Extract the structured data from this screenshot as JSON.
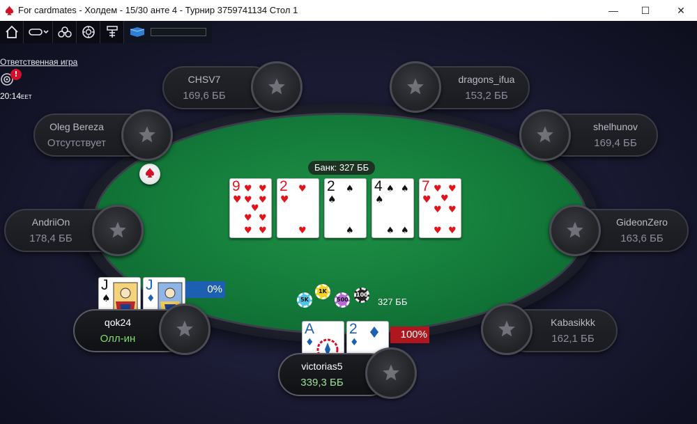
{
  "window": {
    "title": "For cardmates - Холдем - 15/30 анте 4 - Турнир 3759741134 Стол 1",
    "minimize": "—",
    "maximize": "☐",
    "close": "✕"
  },
  "toolbar": {
    "items": [
      "home-icon",
      "view-toggle-icon",
      "cards-icon",
      "poker-chip-icon",
      "lobby-icon",
      "battery-icon"
    ]
  },
  "responsible_gaming": "Ответственная игра",
  "clock": {
    "time": "20:14",
    "tz": "EET"
  },
  "alert": "!",
  "pot": "Банк: 327 ББ",
  "board": [
    {
      "rank": "9",
      "suit": "♥",
      "color": "red"
    },
    {
      "rank": "2",
      "suit": "♥",
      "color": "red"
    },
    {
      "rank": "2",
      "suit": "♠",
      "color": "black"
    },
    {
      "rank": "4",
      "suit": "♠",
      "color": "black"
    },
    {
      "rank": "7",
      "suit": "♥",
      "color": "red"
    }
  ],
  "chips": {
    "labels": [
      "5K",
      "1K",
      "500",
      "100"
    ],
    "amount": "327 ББ"
  },
  "seats": [
    {
      "name": "CHSV7",
      "stack": "169,6 ББ"
    },
    {
      "name": "dragons_ifua",
      "stack": "153,2 ББ"
    },
    {
      "name": "Oleg Bereza",
      "stack": "Отсутствует"
    },
    {
      "name": "shelhunov",
      "stack": "169,4 ББ"
    },
    {
      "name": "AndriiOn",
      "stack": "178,4 ББ"
    },
    {
      "name": "GideonZero",
      "stack": "163,6 ББ"
    },
    {
      "name": "qok24",
      "stack": "Олл-ин"
    },
    {
      "name": "Kabasikkk",
      "stack": "162,1 ББ"
    },
    {
      "name": "victorias5",
      "stack": "339,3 ББ"
    }
  ],
  "hands": {
    "qok24": [
      {
        "rank": "J",
        "suit": "♠"
      },
      {
        "rank": "J",
        "suit": "♦"
      }
    ],
    "victorias5": [
      {
        "rank": "A",
        "suit": "♦"
      },
      {
        "rank": "2",
        "suit": "♦"
      }
    ]
  },
  "equity": {
    "qok24": "0%",
    "victorias5": "100%"
  },
  "colors": {
    "felt": "#13793a",
    "red_suit": "#e1141c",
    "blue_equity": "#1d5fb0",
    "red_equity": "#b0161d"
  }
}
